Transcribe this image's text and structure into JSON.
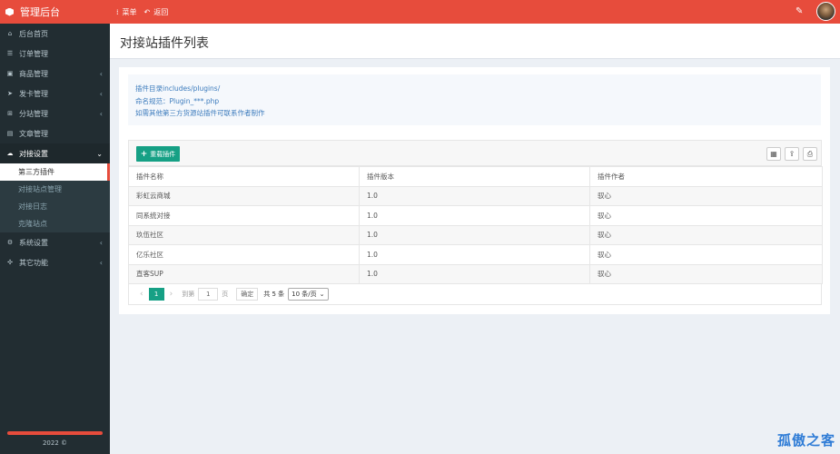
{
  "app": {
    "title": "管理后台"
  },
  "topnav": [
    {
      "icon": "menu-icon",
      "label": "菜单"
    },
    {
      "icon": "back-icon",
      "label": "返回"
    }
  ],
  "sidebar": {
    "items": [
      {
        "icon": "home-icon",
        "label": "后台首页",
        "chevron": false
      },
      {
        "icon": "list-icon",
        "label": "订单管理",
        "chevron": false
      },
      {
        "icon": "shop-icon",
        "label": "商品管理",
        "chevron": true
      },
      {
        "icon": "send-icon",
        "label": "发卡管理",
        "chevron": true
      },
      {
        "icon": "sitemap-icon",
        "label": "分站管理",
        "chevron": true
      },
      {
        "icon": "article-icon",
        "label": "文章管理",
        "chevron": false
      },
      {
        "icon": "connect-icon",
        "label": "对接设置",
        "chevron": true,
        "open": true
      }
    ],
    "sub_items": [
      {
        "label": "第三方插件",
        "active": true
      },
      {
        "label": "对接站点管理"
      },
      {
        "label": "对接日志"
      },
      {
        "label": "克隆站点"
      }
    ],
    "tail_items": [
      {
        "icon": "gear-icon",
        "label": "系统设置",
        "chevron": true
      },
      {
        "icon": "plugin-icon",
        "label": "其它功能",
        "chevron": true
      }
    ],
    "copyright": "2022 ©"
  },
  "page": {
    "title": "对接站插件列表"
  },
  "notes": [
    "插件目录includes/plugins/",
    "命名规范：Plugin_***.php",
    "如需其他第三方货源站插件可联系作者制作"
  ],
  "toolbar": {
    "reload_label": "重载插件"
  },
  "table": {
    "columns": [
      "插件名称",
      "插件版本",
      "插件作者"
    ],
    "rows": [
      [
        "彩虹云商城",
        "1.0",
        "驭心"
      ],
      [
        "同系统对接",
        "1.0",
        "驭心"
      ],
      [
        "玖伍社区",
        "1.0",
        "驭心"
      ],
      [
        "亿乐社区",
        "1.0",
        "驭心"
      ],
      [
        "直客SUP",
        "1.0",
        "驭心"
      ]
    ]
  },
  "pager": {
    "current": "1",
    "goto_label": "到第",
    "goto_value": "1",
    "page_label": "页",
    "confirm_label": "确定",
    "total": "共 5 条",
    "page_size": "10 条/页"
  },
  "watermark": "孤傲之客",
  "colors": {
    "accent": "#e74c3c",
    "primary": "#16a085",
    "sidebar": "#222d32"
  }
}
